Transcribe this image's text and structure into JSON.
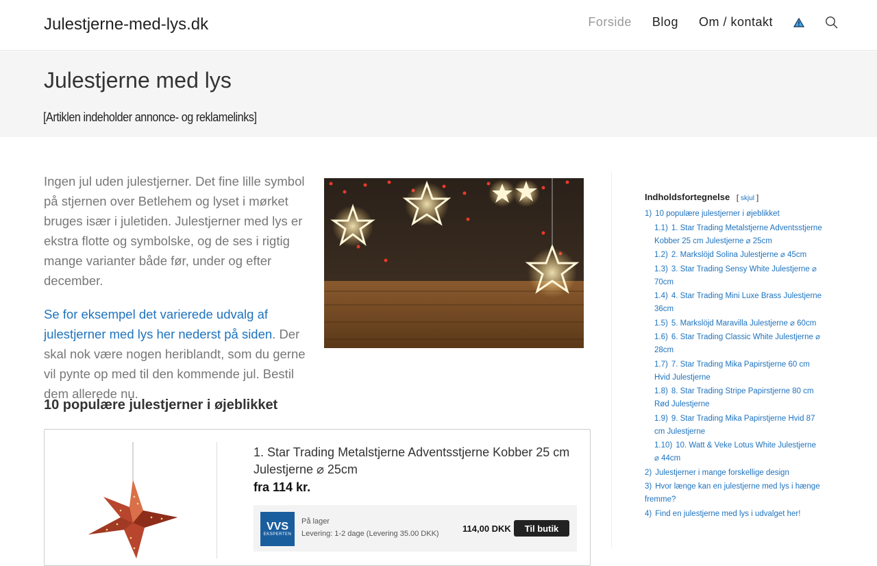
{
  "header": {
    "site_title": "Julestjerne-med-lys.dk",
    "nav": [
      {
        "label": "Forside",
        "active": true
      },
      {
        "label": "Blog",
        "active": false
      },
      {
        "label": "Om / kontakt",
        "active": false
      }
    ],
    "icons": [
      "warning-icon",
      "search-icon"
    ]
  },
  "title_band": {
    "title": "Julestjerne med lys",
    "disclaimer": "[Artiklen indeholder annonce- og reklamelinks]"
  },
  "intro": {
    "paragraph1": "Ingen jul uden julestjerner. Det fine lille symbol på stjernen over Betlehem og lyset i mørket bruges især i juletiden. Julestjerner med lys er ekstra flotte og symbolske, og de ses i rigtig mange varianter både før, under og efter december.",
    "link_text": "Se for eksempel det varierede udvalg af julestjerner med lys her nederst på siden",
    "paragraph2_rest": ". Der skal nok være nogen heriblandt, som du gerne vil pynte op med til den kommende jul. Bestil dem allerede nu."
  },
  "section": {
    "heading": "10 populære julestjerner i øjeblikket"
  },
  "product": {
    "title": "1. Star Trading Metalstjerne Adventsstjerne Kobber 25 cm Julestjerne ⌀ 25cm",
    "price": "fra 114 kr.",
    "offer": {
      "shop_logo_big": "VVS",
      "shop_logo_small": "EKSPERTEN",
      "stock": "På lager",
      "delivery": "Levering: 1-2 dage (Levering 35.00 DKK)",
      "price": "114,00 DKK",
      "button": "Til butik"
    }
  },
  "toc": {
    "title": "Indholdsfortegnelse",
    "toggle_open": "[",
    "toggle_label": "skjul",
    "toggle_close": "]",
    "items": [
      {
        "num": "1)",
        "label": "10 populære julestjerner i øjeblikket",
        "level": 1
      },
      {
        "num": "1.1)",
        "label": "1. Star Trading Metalstjerne Adventsstjerne Kobber 25 cm Julestjerne ⌀ 25cm",
        "level": 2
      },
      {
        "num": "1.2)",
        "label": "2. Markslöjd Solina Julestjerne ⌀ 45cm",
        "level": 2
      },
      {
        "num": "1.3)",
        "label": "3. Star Trading Sensy White Julestjerne ⌀ 70cm",
        "level": 2
      },
      {
        "num": "1.4)",
        "label": "4. Star Trading Mini Luxe Brass Julestjerne 36cm",
        "level": 2
      },
      {
        "num": "1.5)",
        "label": "5. Markslöjd Maravilla Julestjerne ⌀ 60cm",
        "level": 2
      },
      {
        "num": "1.6)",
        "label": "6. Star Trading Classic White Julestjerne ⌀ 28cm",
        "level": 2
      },
      {
        "num": "1.7)",
        "label": "7. Star Trading Mika Papirstjerne 60 cm Hvid Julestjerne",
        "level": 2
      },
      {
        "num": "1.8)",
        "label": "8. Star Trading Stripe Papirstjerne 80 cm Rød Julestjerne",
        "level": 2
      },
      {
        "num": "1.9)",
        "label": "9. Star Trading Mika Papirstjerne Hvid 87 cm Julestjerne",
        "level": 2
      },
      {
        "num": "1.10)",
        "label": "10. Watt & Veke Lotus White Julestjerne ⌀ 44cm",
        "level": 2
      },
      {
        "num": "2)",
        "label": "Julestjerner i mange forskellige design",
        "level": 1
      },
      {
        "num": "3)",
        "label": "Hvor længe kan en julestjerne med lys i hænge fremme?",
        "level": 1
      },
      {
        "num": "4)",
        "label": "Find en julestjerne med lys i udvalget her!",
        "level": 1
      }
    ]
  },
  "colors": {
    "link": "#1e73be",
    "title_band_bg": "#f5f5f5",
    "button_bg": "#222222",
    "shop_logo_bg": "#1b5e9e"
  }
}
